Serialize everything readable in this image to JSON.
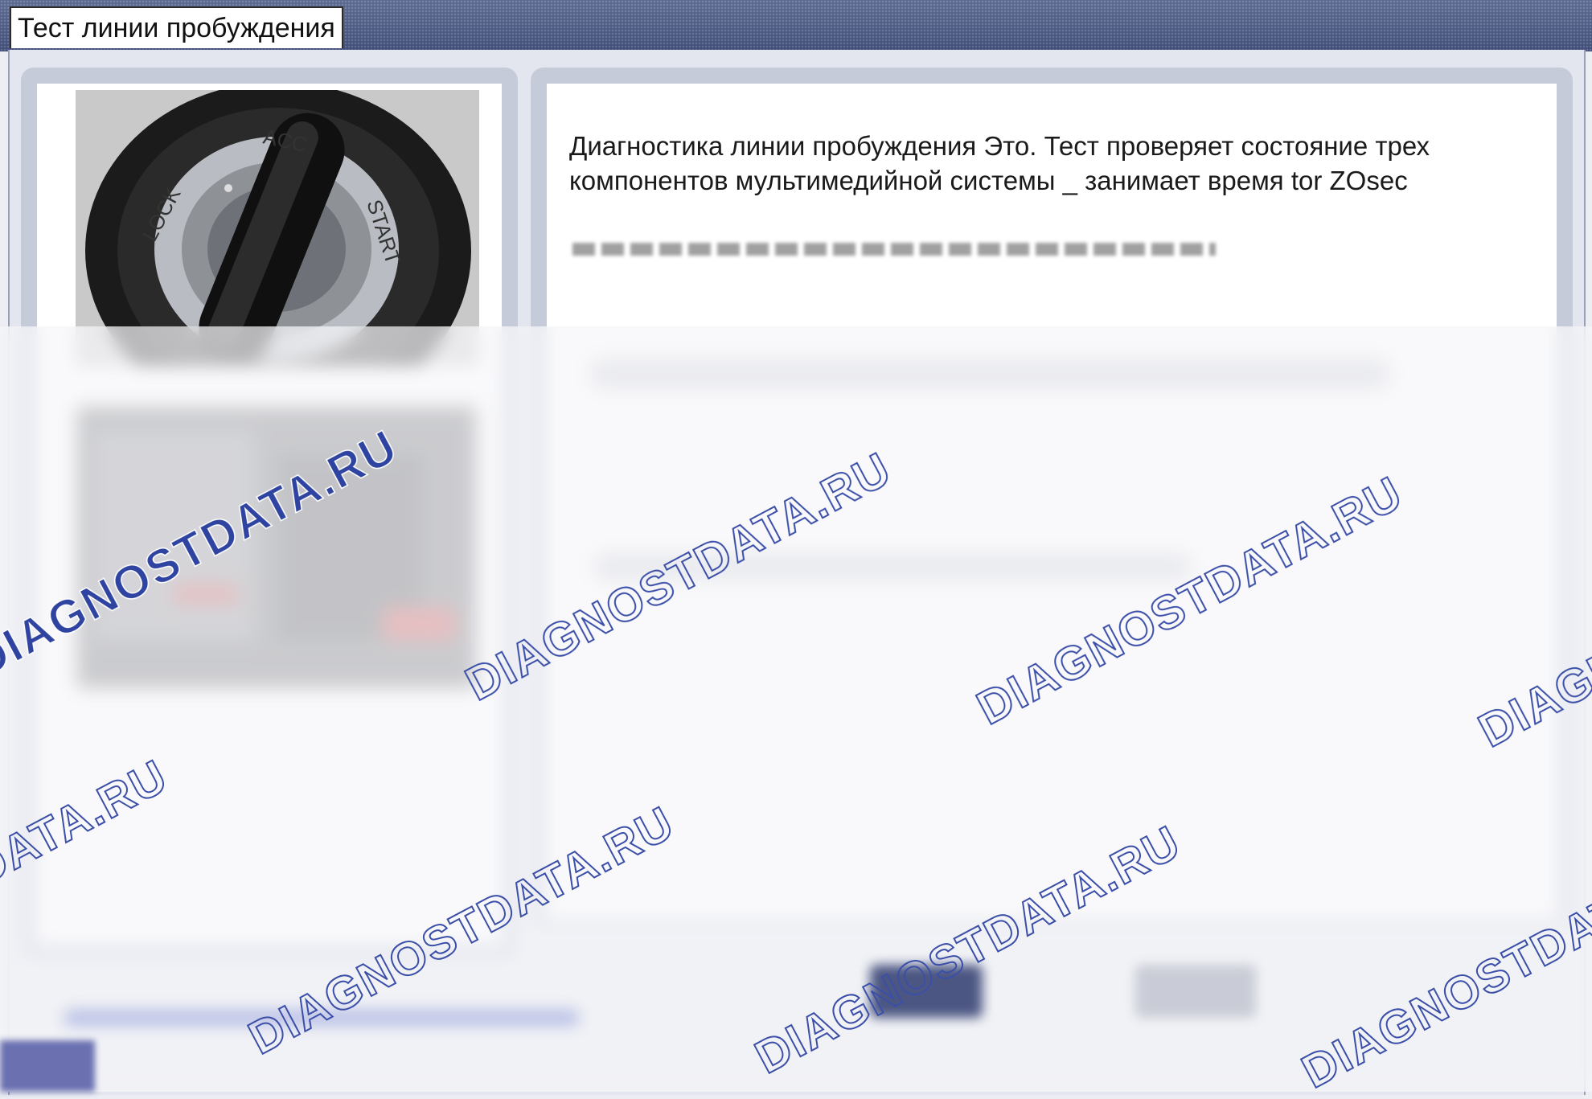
{
  "window": {
    "title": "Тест линии пробуждения"
  },
  "description": {
    "line1": "Диагностика линии пробуждения Это. Тест проверяет состояние трех",
    "line2": "компонентов мультимедийной системы _ занимает время tor ZOsec"
  },
  "images": {
    "top": "ignition-switch-icon",
    "bottom": "connector-photo"
  },
  "watermark": {
    "text": "DIAGNOSTDATA.RU",
    "color": "#3b4fa8"
  }
}
